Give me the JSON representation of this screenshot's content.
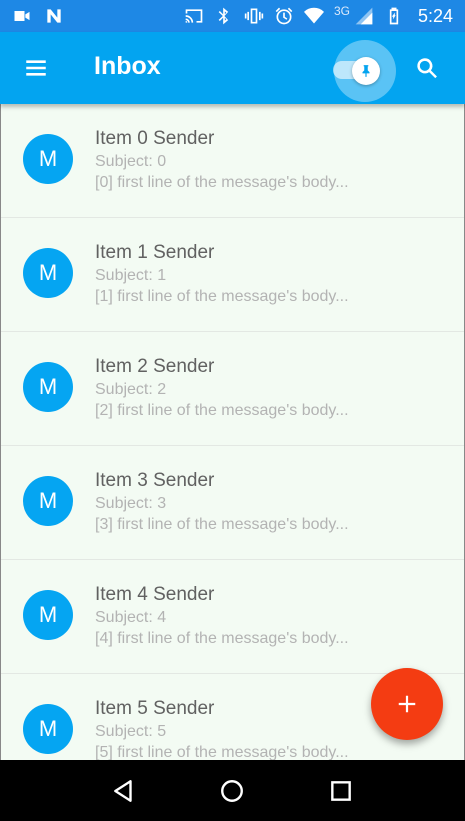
{
  "status_bar": {
    "time": "5:24",
    "network": "3G",
    "icons": [
      "video-camera-icon",
      "n-logo-icon",
      "cast-icon",
      "bluetooth-icon",
      "vibrate-icon",
      "alarm-icon",
      "wifi-icon",
      "cell-signal-icon",
      "battery-icon"
    ]
  },
  "app_bar": {
    "title": "Inbox",
    "menu_icon": "menu-icon",
    "pin_icon": "pin-icon",
    "search_icon": "search-icon",
    "pin_toggle_on": true,
    "color": "#03a4f0"
  },
  "messages": [
    {
      "avatar": "M",
      "sender": "Item 0 Sender",
      "subject": "Subject: 0",
      "snippet": "[0] first line of the message's body..."
    },
    {
      "avatar": "M",
      "sender": "Item 1 Sender",
      "subject": "Subject: 1",
      "snippet": "[1] first line of the message's body..."
    },
    {
      "avatar": "M",
      "sender": "Item 2 Sender",
      "subject": "Subject: 2",
      "snippet": "[2] first line of the message's body..."
    },
    {
      "avatar": "M",
      "sender": "Item 3 Sender",
      "subject": "Subject: 3",
      "snippet": "[3] first line of the message's body..."
    },
    {
      "avatar": "M",
      "sender": "Item 4 Sender",
      "subject": "Subject: 4",
      "snippet": "[4] first line of the message's body..."
    },
    {
      "avatar": "M",
      "sender": "Item 5 Sender",
      "subject": "Subject: 5",
      "snippet": "[5] first line of the message's body..."
    }
  ],
  "fab": {
    "icon": "plus-icon",
    "color": "#f43c12"
  },
  "nav_bar": {
    "icons": [
      "back-icon",
      "home-icon",
      "recents-icon"
    ]
  }
}
